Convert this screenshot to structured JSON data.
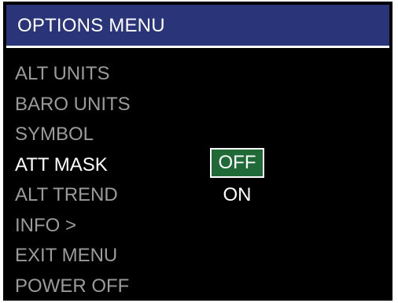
{
  "header": {
    "title": "OPTIONS MENU"
  },
  "menu": {
    "items": [
      {
        "label": "ALT UNITS"
      },
      {
        "label": "BARO UNITS"
      },
      {
        "label": "SYMBOL"
      },
      {
        "label": "ATT MASK"
      },
      {
        "label": "ALT TREND"
      },
      {
        "label": "INFO >"
      },
      {
        "label": "EXIT MENU"
      },
      {
        "label": "POWER OFF"
      }
    ]
  },
  "options": {
    "selected": "OFF",
    "choices": [
      {
        "label": "OFF"
      },
      {
        "label": "ON"
      }
    ]
  },
  "colors": {
    "header_bg": "#2a3579",
    "selected_bg": "#1f6a37",
    "inactive_text": "#9b9b9b",
    "active_text": "#ffffff",
    "background": "#000000"
  }
}
